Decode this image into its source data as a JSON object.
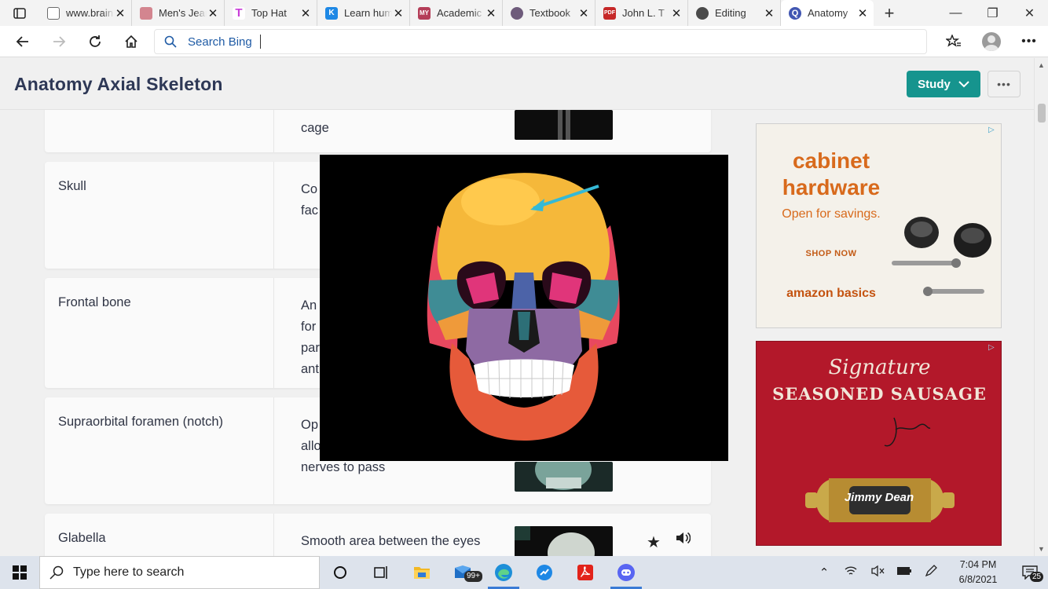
{
  "browser": {
    "tabs": [
      {
        "title": "www.brainscape.com",
        "icon": "page-icon",
        "color": "#6b6b6b"
      },
      {
        "title": "Men's Jeans",
        "icon": "kite-icon",
        "color": "#d3858f"
      },
      {
        "title": "Top Hat",
        "icon": "tophat-icon",
        "color": "#c83dd8"
      },
      {
        "title": "Learn human anatomy",
        "icon": "k-icon",
        "color": "#1e88e5"
      },
      {
        "title": "Academic",
        "icon": "my-icon",
        "color": "#b43d58"
      },
      {
        "title": "Textbook",
        "icon": "textbook-icon",
        "color": "#6e5b7b"
      },
      {
        "title": "John L. T",
        "icon": "pdf-icon",
        "color": "#c62828"
      },
      {
        "title": "Editing",
        "icon": "robot-icon",
        "color": "#4a4a4a"
      },
      {
        "title": "Anatomy",
        "icon": "quizlet-icon",
        "color": "#4257b2"
      }
    ],
    "address_placeholder": "Search Bing",
    "window_controls": {
      "minimize": "—",
      "restore": "❐",
      "close": "✕"
    }
  },
  "header": {
    "title": "Anatomy Axial Skeleton",
    "study_label": "Study",
    "more_label": "•••"
  },
  "cards": [
    {
      "term": "",
      "definition": "cage"
    },
    {
      "term": "Skull",
      "definition": "Co\nfac"
    },
    {
      "term": "Frontal bone",
      "definition": "An\nfor\npar\nant"
    },
    {
      "term": "Supraorbital foramen (notch)",
      "definition": "Op\nallo\nnerves to pass"
    },
    {
      "term": "Glabella",
      "definition": "Smooth area between the eyes"
    }
  ],
  "ads": {
    "ad1": {
      "headline": "cabinet hardware",
      "subline": "Open for savings.",
      "cta": "SHOP NOW",
      "brand": "amazon basics"
    },
    "ad2": {
      "script": "Signature",
      "headline": "SEASONED SAUSAGE",
      "brand": "Jimmy Dean"
    }
  },
  "taskbar": {
    "search_placeholder": "Type here to search",
    "mail_badge": "99+",
    "time": "7:04 PM",
    "date": "6/8/2021",
    "notifications": "25"
  },
  "colors": {
    "accent": "#16948e",
    "title": "#2e3856",
    "link": "#1f5ba5"
  }
}
